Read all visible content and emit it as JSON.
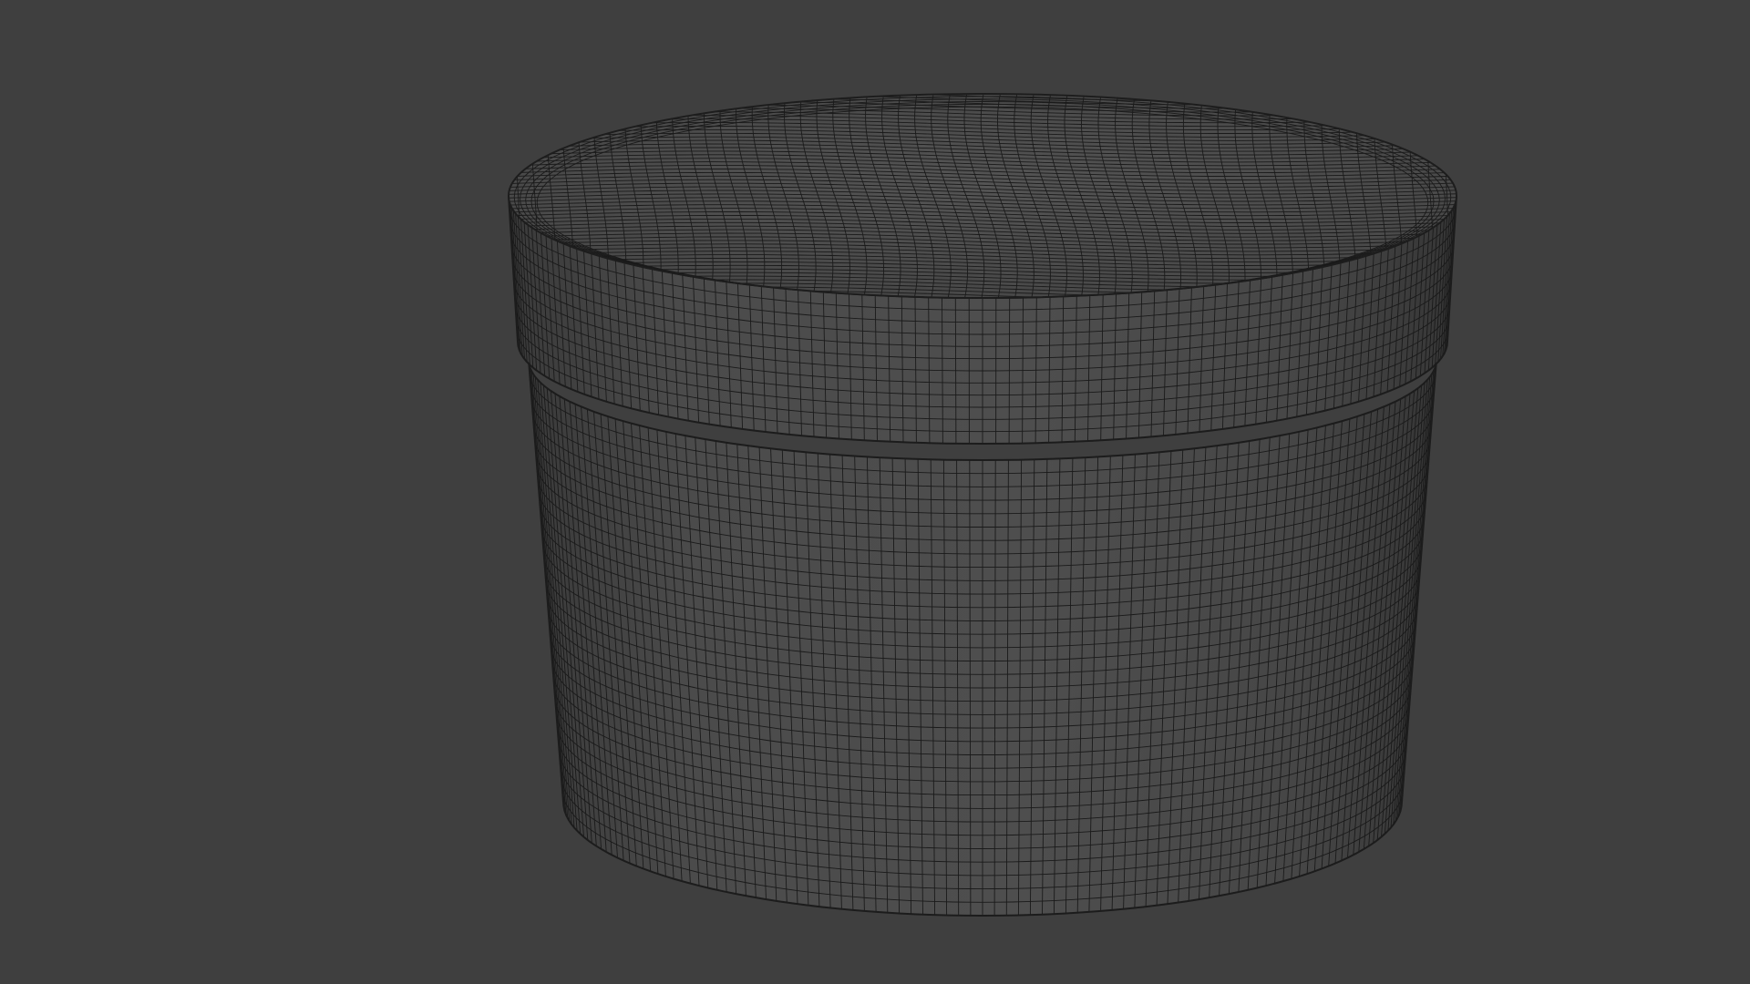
{
  "viewport": {
    "background_color": "#3f3f3f",
    "shade_top": "#525252",
    "shade_side": "#4a4a4a",
    "shade_dark": "#353535",
    "wire_color": "#1a1a1a"
  },
  "subject": {
    "icon": "wireframe-jar-mesh"
  }
}
